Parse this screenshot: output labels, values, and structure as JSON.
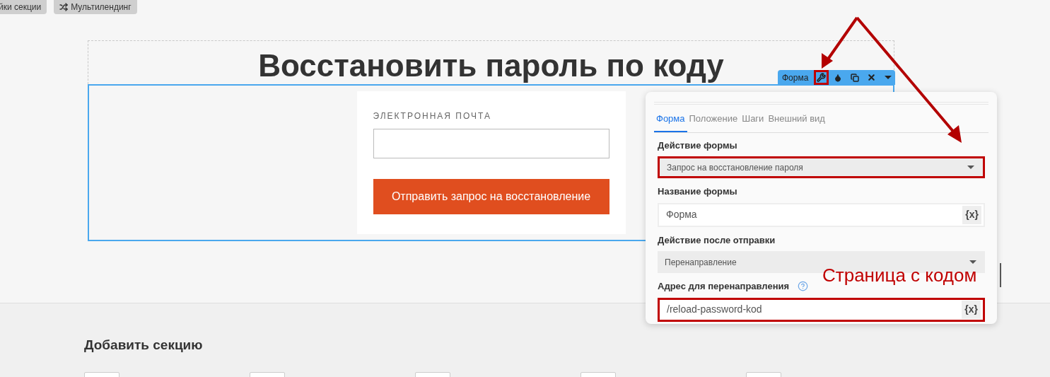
{
  "top_buttons": [
    {
      "kind": "plain",
      "label": "йки секции"
    },
    {
      "kind": "shuffle",
      "label": "Мультилендинг"
    }
  ],
  "section": {
    "title": "Восстановить пароль по коду"
  },
  "form": {
    "email_label": "ЭЛЕКТРОННАЯ ПОЧТА",
    "submit": "Отправить запрос на восстановление"
  },
  "toolbar": {
    "label": "Форма",
    "tools": [
      {
        "kind": "wrench",
        "highlighted": true
      },
      {
        "kind": "drop",
        "highlighted": false
      },
      {
        "kind": "copy",
        "highlighted": false
      },
      {
        "kind": "close",
        "highlighted": false
      },
      {
        "kind": "caret",
        "highlighted": false
      }
    ]
  },
  "panel": {
    "tabs": [
      {
        "label": "Форма",
        "selected": true
      },
      {
        "label": "Положение",
        "selected": false
      },
      {
        "label": "Шаги",
        "selected": false
      },
      {
        "label": "Внешний вид",
        "selected": false
      }
    ],
    "fields": [
      {
        "kind": "select",
        "label": "Действие формы",
        "value": "Запрос на восстановление пароля",
        "highlighted": true
      },
      {
        "kind": "text",
        "label": "Название формы",
        "value": "Форма",
        "variable_button": "{x}",
        "help": false,
        "highlighted": false
      },
      {
        "kind": "select",
        "label": "Действие после отправки",
        "value": "Перенаправление",
        "highlighted": false
      },
      {
        "kind": "text",
        "label": "Адрес для перенаправления",
        "value": "/reload-password-kod",
        "variable_button": "{x}",
        "help": true,
        "highlighted": true
      }
    ]
  },
  "annotation": {
    "text": "Страница с кодом"
  },
  "add_section": {
    "title": "Добавить секцию"
  }
}
